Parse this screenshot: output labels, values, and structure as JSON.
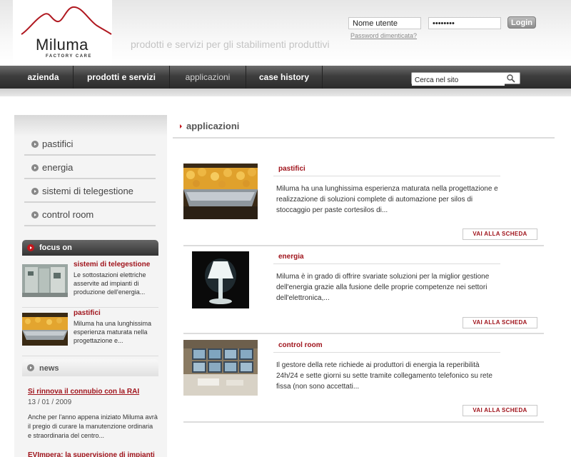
{
  "brand": {
    "name": "Miluma",
    "subtitle": "FACTORY CARE",
    "tagline": "prodotti e servizi per gli stabilimenti produttivi"
  },
  "login": {
    "username_value": "Nome utente",
    "password_value": "••••••••",
    "login_label": "Login",
    "forgot_label": "Password dimenticata?"
  },
  "nav": {
    "items": [
      {
        "label": "azienda"
      },
      {
        "label": "prodotti e servizi"
      },
      {
        "label": "applicazioni"
      },
      {
        "label": "case history"
      }
    ],
    "active": "applicazioni"
  },
  "search": {
    "value": "Cerca nel sito"
  },
  "sidebar": {
    "items": [
      {
        "label": "pastifici"
      },
      {
        "label": "energia"
      },
      {
        "label": "sistemi di telegestione"
      },
      {
        "label": "control room"
      }
    ],
    "focus": {
      "heading": "focus on",
      "items": [
        {
          "title": "sistemi di telegestione",
          "text": "Le sottostazioni elettriche asservite ad impianti di produzione dell'energia..."
        },
        {
          "title": "pastifici",
          "text": "Miluma ha una lunghissima esperienza maturata nella progettazione e..."
        }
      ]
    },
    "news": {
      "heading": "news",
      "items": [
        {
          "title": "Si rinnova il connubio con la RAI",
          "date": "13 / 01 / 2009",
          "text": "Anche per l'anno appena iniziato Miluma avrà il pregio di curare la manutenzione ordinaria e straordinaria del centro..."
        },
        {
          "title": "EVImpera: la supervisione di impianti"
        }
      ]
    }
  },
  "main": {
    "title": "applicazioni",
    "cards": [
      {
        "title": "pastifici",
        "text": "Miluma ha una lunghissima esperienza maturata nella progettazione e realizzazione di soluzioni complete di automazione per silos di stoccaggio per paste cortesilos di...",
        "button": "VAI ALLA SCHEDA"
      },
      {
        "title": "energia",
        "text": "Miluma è in grado di offrire svariate soluzioni per la miglior gestione dell'energia grazie alla fusione delle proprie competenze nei settori dell'elettronica,...",
        "button": "VAI ALLA SCHEDA"
      },
      {
        "title": "control room",
        "text": "Il gestore della rete richiede ai produttori di energia la reperibilità 24h/24 e sette giorni su sette tramite collegamento telefonico su rete fissa (non sono accettati...",
        "button": "VAI ALLA SCHEDA"
      }
    ]
  },
  "colors": {
    "accent": "#a0141c",
    "nav_bg": "#333333"
  }
}
